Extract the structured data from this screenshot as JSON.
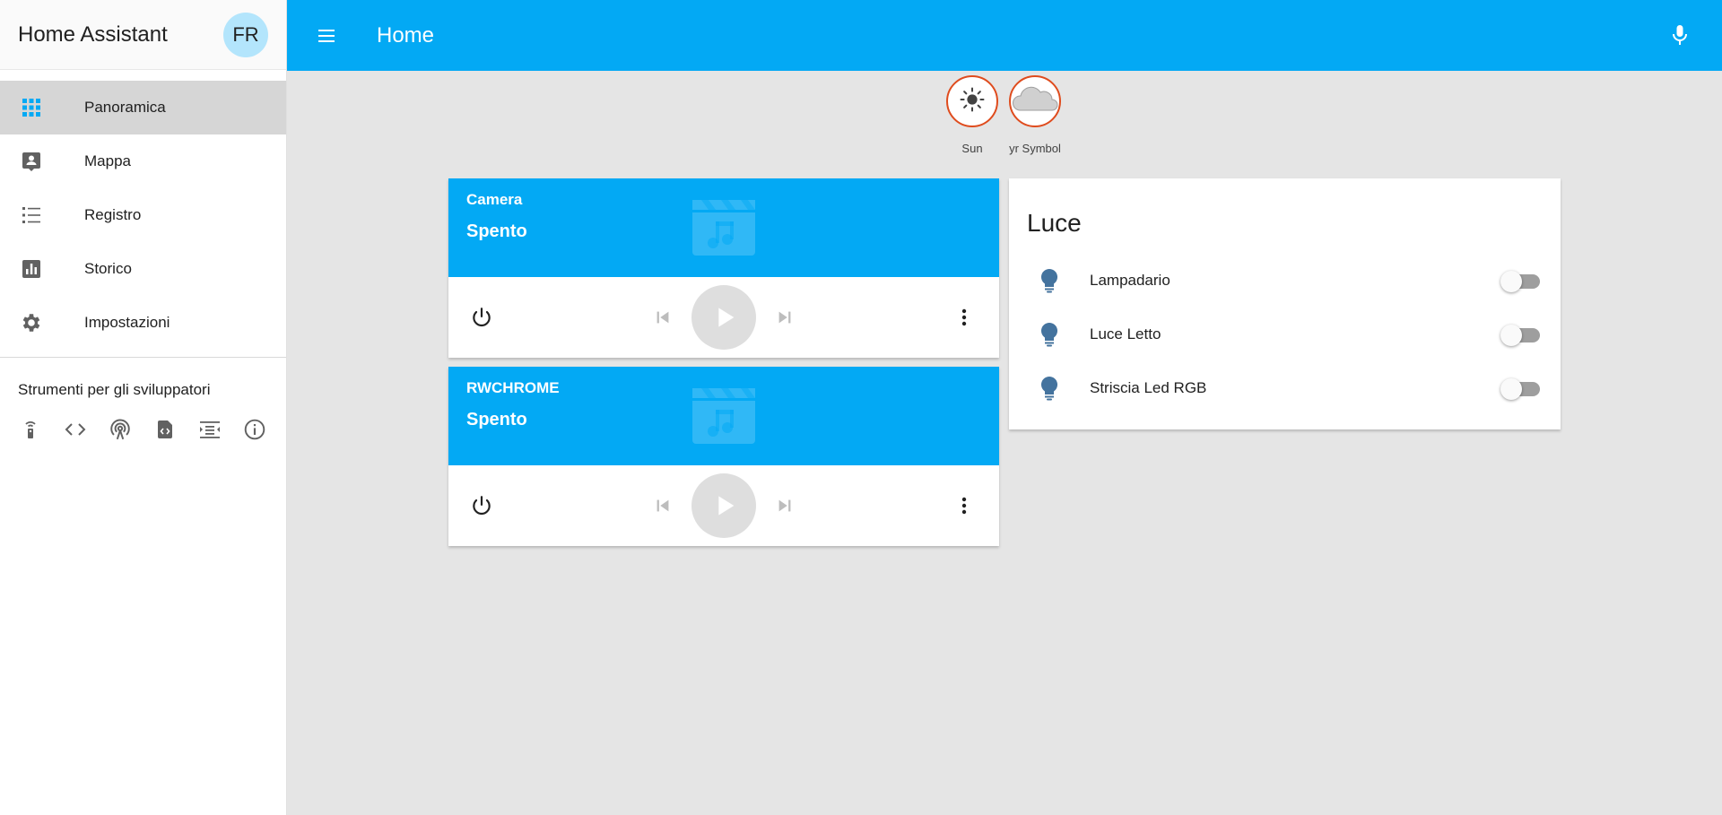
{
  "sidebar": {
    "title": "Home Assistant",
    "avatar": "FR",
    "items": [
      {
        "label": "Panoramica",
        "icon": "grid-icon",
        "active": true
      },
      {
        "label": "Mappa",
        "icon": "map-account-icon"
      },
      {
        "label": "Registro",
        "icon": "list-icon"
      },
      {
        "label": "Storico",
        "icon": "chart-icon"
      },
      {
        "label": "Impostazioni",
        "icon": "gear-icon"
      }
    ],
    "dev_title": "Strumenti per gli sviluppatori",
    "dev_tools": [
      "remote-icon",
      "code-icon",
      "antenna-icon",
      "file-code-icon",
      "template-icon",
      "info-icon"
    ]
  },
  "header": {
    "title": "Home",
    "color": "#03a9f4"
  },
  "badges": [
    {
      "label": "Sun",
      "icon": "sun-icon"
    },
    {
      "label": "yr Symbol",
      "icon": "cloud-icon"
    }
  ],
  "media_players": [
    {
      "name": "Camera",
      "state": "Spento"
    },
    {
      "name": "RWCHROME",
      "state": "Spento"
    }
  ],
  "light_card": {
    "title": "Luce",
    "items": [
      {
        "name": "Lampadario",
        "on": false
      },
      {
        "name": "Luce Letto",
        "on": false
      },
      {
        "name": "Striscia Led RGB",
        "on": false
      }
    ]
  },
  "colors": {
    "accent": "#03a9f4",
    "badge_border": "#df4c1e",
    "bulb": "#44739e"
  }
}
